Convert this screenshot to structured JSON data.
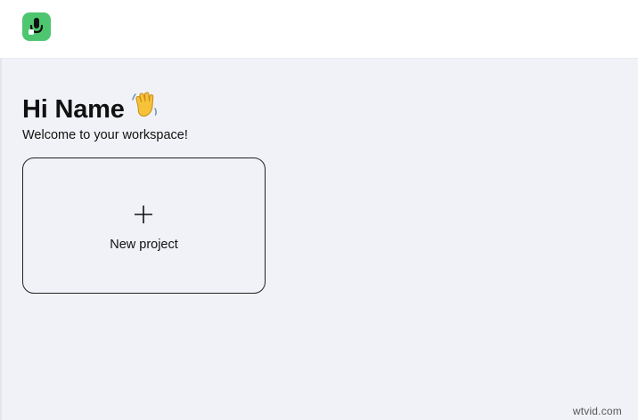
{
  "header": {
    "logo_icon": "microphone-icon",
    "logo_color": "#4ec66f"
  },
  "main": {
    "greeting": "Hi Name",
    "greeting_emoji_icon": "waving-hand-icon",
    "subtitle": "Welcome to your workspace!",
    "new_project": {
      "icon": "plus-icon",
      "label": "New project"
    }
  },
  "watermark": "wtvid.com"
}
